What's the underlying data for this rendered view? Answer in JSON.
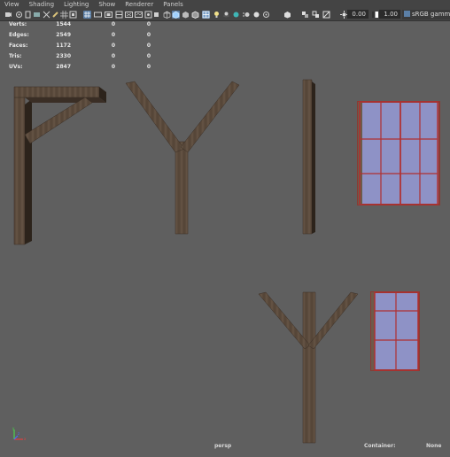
{
  "menubar": {
    "items": [
      {
        "label": "View"
      },
      {
        "label": "Shading"
      },
      {
        "label": "Lighting"
      },
      {
        "label": "Show"
      },
      {
        "label": "Renderer"
      },
      {
        "label": "Panels"
      }
    ]
  },
  "toolbar": {
    "exposure_value": "0.00",
    "gamma_value": "1.00",
    "color_space_label": "sRGB gamma"
  },
  "hud": {
    "rows": [
      {
        "label": "Verts:",
        "v1": "1544",
        "v2": "0",
        "v3": "0"
      },
      {
        "label": "Edges:",
        "v1": "2549",
        "v2": "0",
        "v3": "0"
      },
      {
        "label": "Faces:",
        "v1": "1172",
        "v2": "0",
        "v3": "0"
      },
      {
        "label": "Tris:",
        "v1": "2330",
        "v2": "0",
        "v3": "0"
      },
      {
        "label": "UVs:",
        "v1": "2847",
        "v2": "0",
        "v3": "0"
      }
    ]
  },
  "viewport": {
    "camera_name": "persp",
    "container_label": "Container:",
    "container_value": "None",
    "background_color": "#5f5f5f",
    "wood_color": "#5a4a3c",
    "window_glass_color": "#8e92c6",
    "window_frame_color": "#b03030"
  },
  "axis_labels": {
    "x": "x",
    "y": "y",
    "z": "z"
  }
}
